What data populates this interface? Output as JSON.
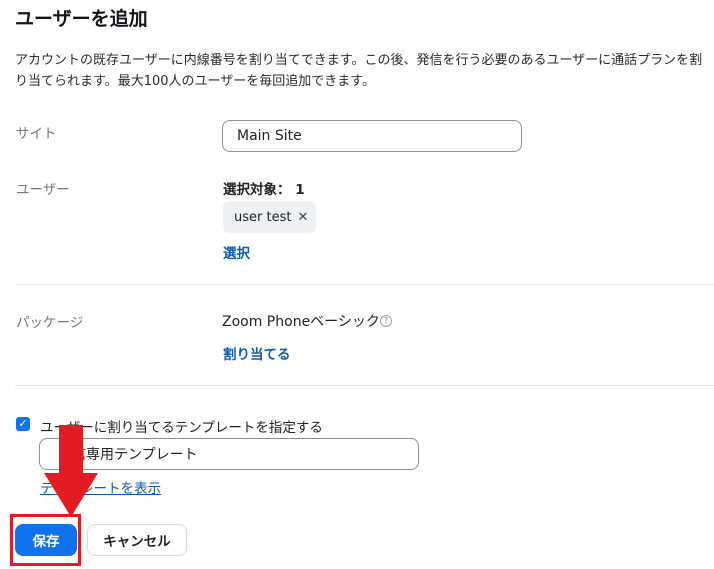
{
  "page": {
    "title": "ユーザーを追加",
    "description": "アカウントの既存ユーザーに内線番号を割り当てできます。この後、発信を行う必要のあるユーザーに通話プランを割り当てられます。最大100人のユーザーを毎回追加できます。"
  },
  "site": {
    "label": "サイト",
    "value": "Main Site"
  },
  "users": {
    "label": "ユーザー",
    "selected_count_text": "選択対象： 1",
    "chips": [
      {
        "label": "user test"
      }
    ],
    "select_link": "選択"
  },
  "package": {
    "label": "パッケージ",
    "value": "Zoom Phoneベーシック",
    "help_icon": "question-circle-icon",
    "assign_link": "割り当てる"
  },
  "template": {
    "checkbox_label": "ユーザーに割り当てるテンプレートを指定する",
    "checked": true,
    "value": "信専用テンプレート",
    "show_link": "テンプレートを表示"
  },
  "actions": {
    "save": "保存",
    "cancel": "キャンセル"
  },
  "annotation": {
    "arrow_color": "#e31b23",
    "highlight_color": "#e31b23"
  },
  "colors": {
    "accent": "#0e72ed",
    "link": "#0e5bb5"
  }
}
